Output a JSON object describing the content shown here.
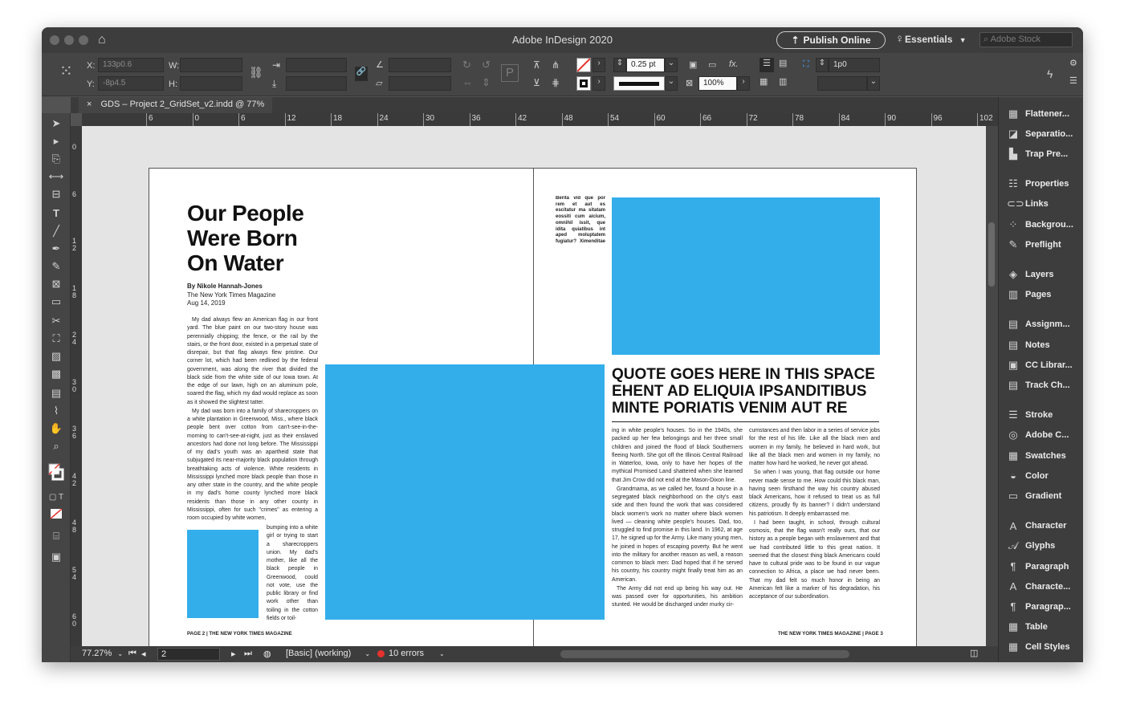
{
  "app": {
    "title": "Adobe InDesign 2020",
    "publish_label": "Publish Online",
    "workspace_label": "Essentials",
    "stock_placeholder": "Adobe Stock"
  },
  "control": {
    "x_label": "X:",
    "x_value": "133p0.6",
    "y_label": "Y:",
    "y_value": "-8p4.5",
    "w_label": "W:",
    "h_label": "H:",
    "stroke_weight": "0.25 pt",
    "opacity": "100%",
    "offset": "1p0"
  },
  "doc_tab": {
    "close": "×",
    "title": "GDS – Project 2_GridSet_v2.indd @ 77%"
  },
  "rulers": {
    "h_ticks": [
      "6",
      "0",
      "6",
      "12",
      "18",
      "24",
      "30",
      "36",
      "42",
      "48",
      "54",
      "60",
      "66",
      "72",
      "78",
      "84",
      "90",
      "96",
      "102",
      "10"
    ],
    "v_ticks": [
      "0",
      "6",
      "1 2",
      "1 8",
      "2 4",
      "3 0",
      "3 6",
      "4 2",
      "4 8",
      "5 4",
      "6 0"
    ]
  },
  "status": {
    "zoom": "77.27%",
    "page": "2",
    "preflight_profile": "[Basic] (working)",
    "errors": "10 errors"
  },
  "panels": [
    {
      "label": "Flattener...",
      "icon": "flattener-icon",
      "glyph": "▦"
    },
    {
      "label": "Separatio...",
      "icon": "separations-icon",
      "glyph": "◪"
    },
    {
      "label": "Trap Pre...",
      "icon": "trap-presets-icon",
      "glyph": "▙"
    },
    {
      "label": "Properties",
      "icon": "properties-icon",
      "glyph": "☷"
    },
    {
      "label": "Links",
      "icon": "links-icon",
      "glyph": "⊂⊃"
    },
    {
      "label": "Backgrou...",
      "icon": "background-tasks-icon",
      "glyph": "⁘"
    },
    {
      "label": "Preflight",
      "icon": "preflight-icon",
      "glyph": "✎"
    },
    {
      "label": "Layers",
      "icon": "layers-icon",
      "glyph": "◈"
    },
    {
      "label": "Pages",
      "icon": "pages-icon",
      "glyph": "▥"
    },
    {
      "label": "Assignm...",
      "icon": "assignments-icon",
      "glyph": "▤"
    },
    {
      "label": "Notes",
      "icon": "notes-icon",
      "glyph": "▤"
    },
    {
      "label": "CC Librar...",
      "icon": "cc-libraries-icon",
      "glyph": "▣"
    },
    {
      "label": "Track Ch...",
      "icon": "track-changes-icon",
      "glyph": "▤"
    },
    {
      "label": "Stroke",
      "icon": "stroke-icon",
      "glyph": "☰"
    },
    {
      "label": "Adobe C...",
      "icon": "adobe-color-icon",
      "glyph": "◎"
    },
    {
      "label": "Swatches",
      "icon": "swatches-icon",
      "glyph": "▦"
    },
    {
      "label": "Color",
      "icon": "color-icon",
      "glyph": "◒"
    },
    {
      "label": "Gradient",
      "icon": "gradient-icon",
      "glyph": "▭"
    },
    {
      "label": "Character",
      "icon": "character-icon",
      "glyph": "A"
    },
    {
      "label": "Glyphs",
      "icon": "glyphs-icon",
      "glyph": "𝒜"
    },
    {
      "label": "Paragraph",
      "icon": "paragraph-icon",
      "glyph": "¶"
    },
    {
      "label": "Characte...",
      "icon": "character-styles-icon",
      "glyph": "A"
    },
    {
      "label": "Paragrap...",
      "icon": "paragraph-styles-icon",
      "glyph": "¶"
    },
    {
      "label": "Table",
      "icon": "table-icon",
      "glyph": "▦"
    },
    {
      "label": "Cell Styles",
      "icon": "cell-styles-icon",
      "glyph": "▦"
    }
  ],
  "article": {
    "headline_lines": [
      "Our People",
      "Were Born",
      "On Water"
    ],
    "byline": "By Nikole Hannah-Jones",
    "publication": "The New York Times Magazine",
    "date": "Aug 14, 2019",
    "left_col_p1": "My dad always flew an American flag in our front yard. The blue paint on our two-story house was perennially chipping; the fence, or the rail by the stairs, or the front door, existed in a perpetual state of disrepair, but that flag always flew pristine. Our corner lot, which had been redlined by the federal government, was along the river that divided the black side from the white side of our Iowa town. At the edge of our lawn, high on an aluminum pole, soared the flag, which my dad would replace as soon as it showed the slightest tatter.",
    "left_col_p2": "My dad was born into a family of sharecroppers on a white plantation in Greenwood, Miss., where black people bent over cotton from can't-see-in-the-morning to can't-see-at-night, just as their enslaved ancestors had done not long before. The Mississippi of my dad's youth was an apartheid state that subjugated its near-majority black population through breathtaking acts of violence. White residents in Mississippi lynched more black people than those in any other state in the country, and the white people in my dad's home county lynched more black residents than those in any other county in Mississippi, often for such \"crimes\" as entering a room occupied by white women,",
    "narrow_col": "bumping into a white girl or trying to start a sharecroppers union. My dad's mother, like all the black people in Greenwood, could not vote, use the public library or find work other than toiling in the cotton fields or toil-",
    "sidebar_text": "Berita vid que por rem et aut es escitatur ma sitatam eossiti cum aicium, omnihil issit, que idita quiatibus int aped moluptatem fugiatur? Ximenditae venihen-",
    "quote": "QUOTE GOES HERE IN THIS SPACE EHENT AD ELIQUIA IPSANDITIBUS MINTE PORIATIS VENIM AUT RE",
    "right_col1_p1": "ing in white people's houses. So in the 1940s, she packed up her few belongings and her three small children and joined the flood of black Southerners fleeing North. She got off the Illinois Central Railroad in Waterloo, Iowa, only to have her hopes of the mythical Promised Land shattered when she learned that Jim Crow did not end at the Mason-Dixon line.",
    "right_col1_p2": "Grandmama, as we called her, found a house in a segregated black neighborhood on the city's east side and then found the work that was considered black women's work no matter where black women lived — cleaning white people's houses. Dad, too, struggled to find promise in this land. In 1962, at age 17, he signed up for the Army. Like many young men, he joined in hopes of escaping poverty. But he went into the military for another reason as well, a reason common to black men: Dad hoped that if he served his country, his country might finally treat him as an American.",
    "right_col1_p3": "The Army did not end up being his way out. He was passed over for opportunities, his ambition stunted. He would be discharged under murky cir-",
    "right_col2_p1": "cumstances and then labor in a series of service jobs for the rest of his life. Like all the black men and women in my family, he believed in hard work, but like all the black men and women in my family, no matter how hard he worked, he never got ahead.",
    "right_col2_p2": "So when I was young, that flag outside our home never made sense to me. How could this black man, having seen firsthand the way his country abused black Americans, how it refused to treat us as full citizens, proudly fly its banner? I didn't understand his patriotism. It deeply embarrassed me.",
    "right_col2_p3": "I had been taught, in school, through cultural osmosis, that the flag wasn't really ours, that our history as a people began with enslavement and that we had contributed little to this great nation. It seemed that the closest thing black Americans could have to cultural pride was to be found in our vague connection to Africa, a place we had never been. That my dad felt so much honor in being an American felt like a marker of his degradation, his acceptance of our subordination.",
    "folio_left": "PAGE 2 | THE NEW YORK TIMES MAGAZINE",
    "folio_right": "THE NEW YORK TIMES MAGAZINE | PAGE 3"
  },
  "colors": {
    "accent_blue": "#33aeeb",
    "ui_dark": "#454545",
    "error_red": "#e5322d"
  }
}
